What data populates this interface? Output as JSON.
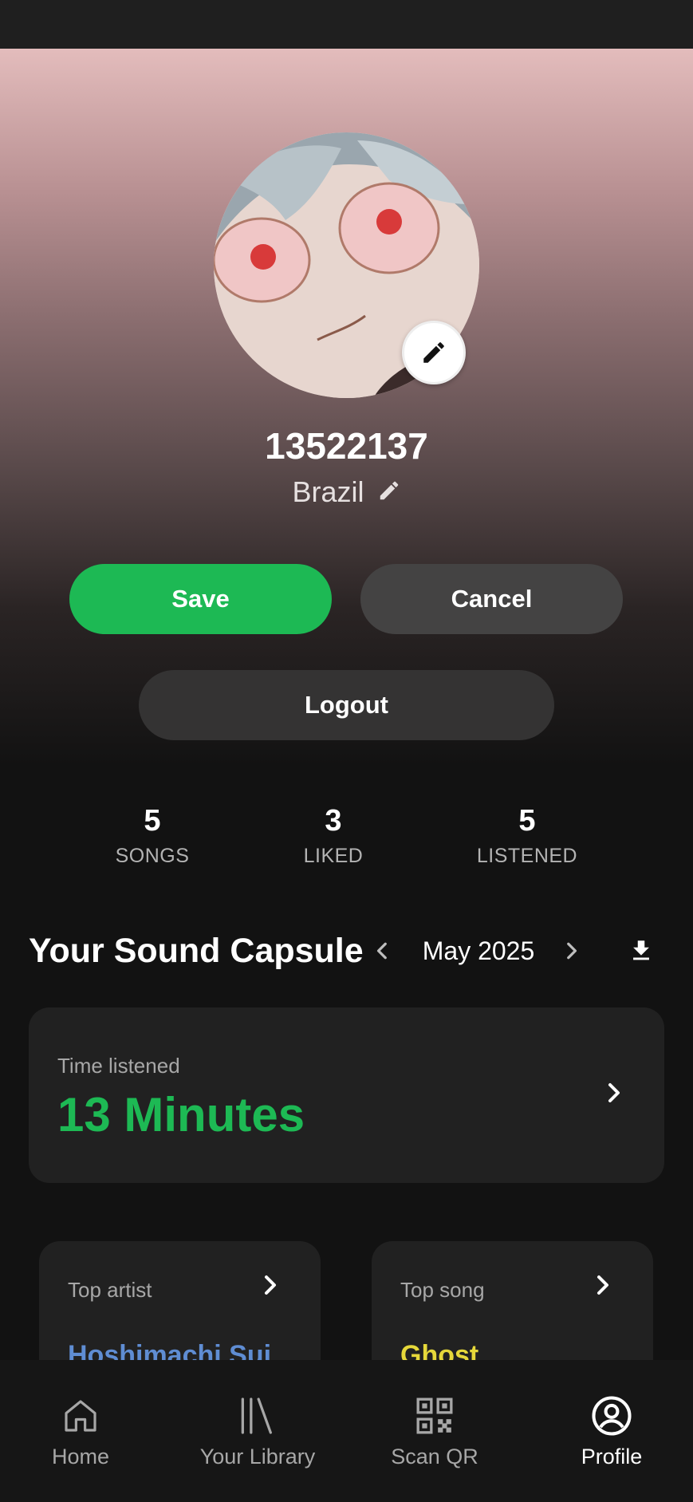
{
  "profile": {
    "username": "13522137",
    "location": "Brazil"
  },
  "actions": {
    "save_label": "Save",
    "cancel_label": "Cancel",
    "logout_label": "Logout"
  },
  "stats": [
    {
      "value": "5",
      "label": "SONGS"
    },
    {
      "value": "3",
      "label": "LIKED"
    },
    {
      "value": "5",
      "label": "LISTENED"
    }
  ],
  "capsule": {
    "title": "Your Sound Capsule",
    "month": "May 2025",
    "time_listened_label": "Time listened",
    "time_listened_value": "13 Minutes",
    "top_artist_label": "Top artist",
    "top_artist_value": "Hoshimachi Sui",
    "top_song_label": "Top song",
    "top_song_value": "Ghost"
  },
  "nav": [
    {
      "label": "Home",
      "icon": "home-icon"
    },
    {
      "label": "Your Library",
      "icon": "library-icon"
    },
    {
      "label": "Scan QR",
      "icon": "qr-code-icon"
    },
    {
      "label": "Profile",
      "icon": "profile-icon",
      "active": true
    }
  ],
  "colors": {
    "accent": "#1db954",
    "top_artist": "#5f8dd3",
    "top_song": "#e6d83a"
  }
}
